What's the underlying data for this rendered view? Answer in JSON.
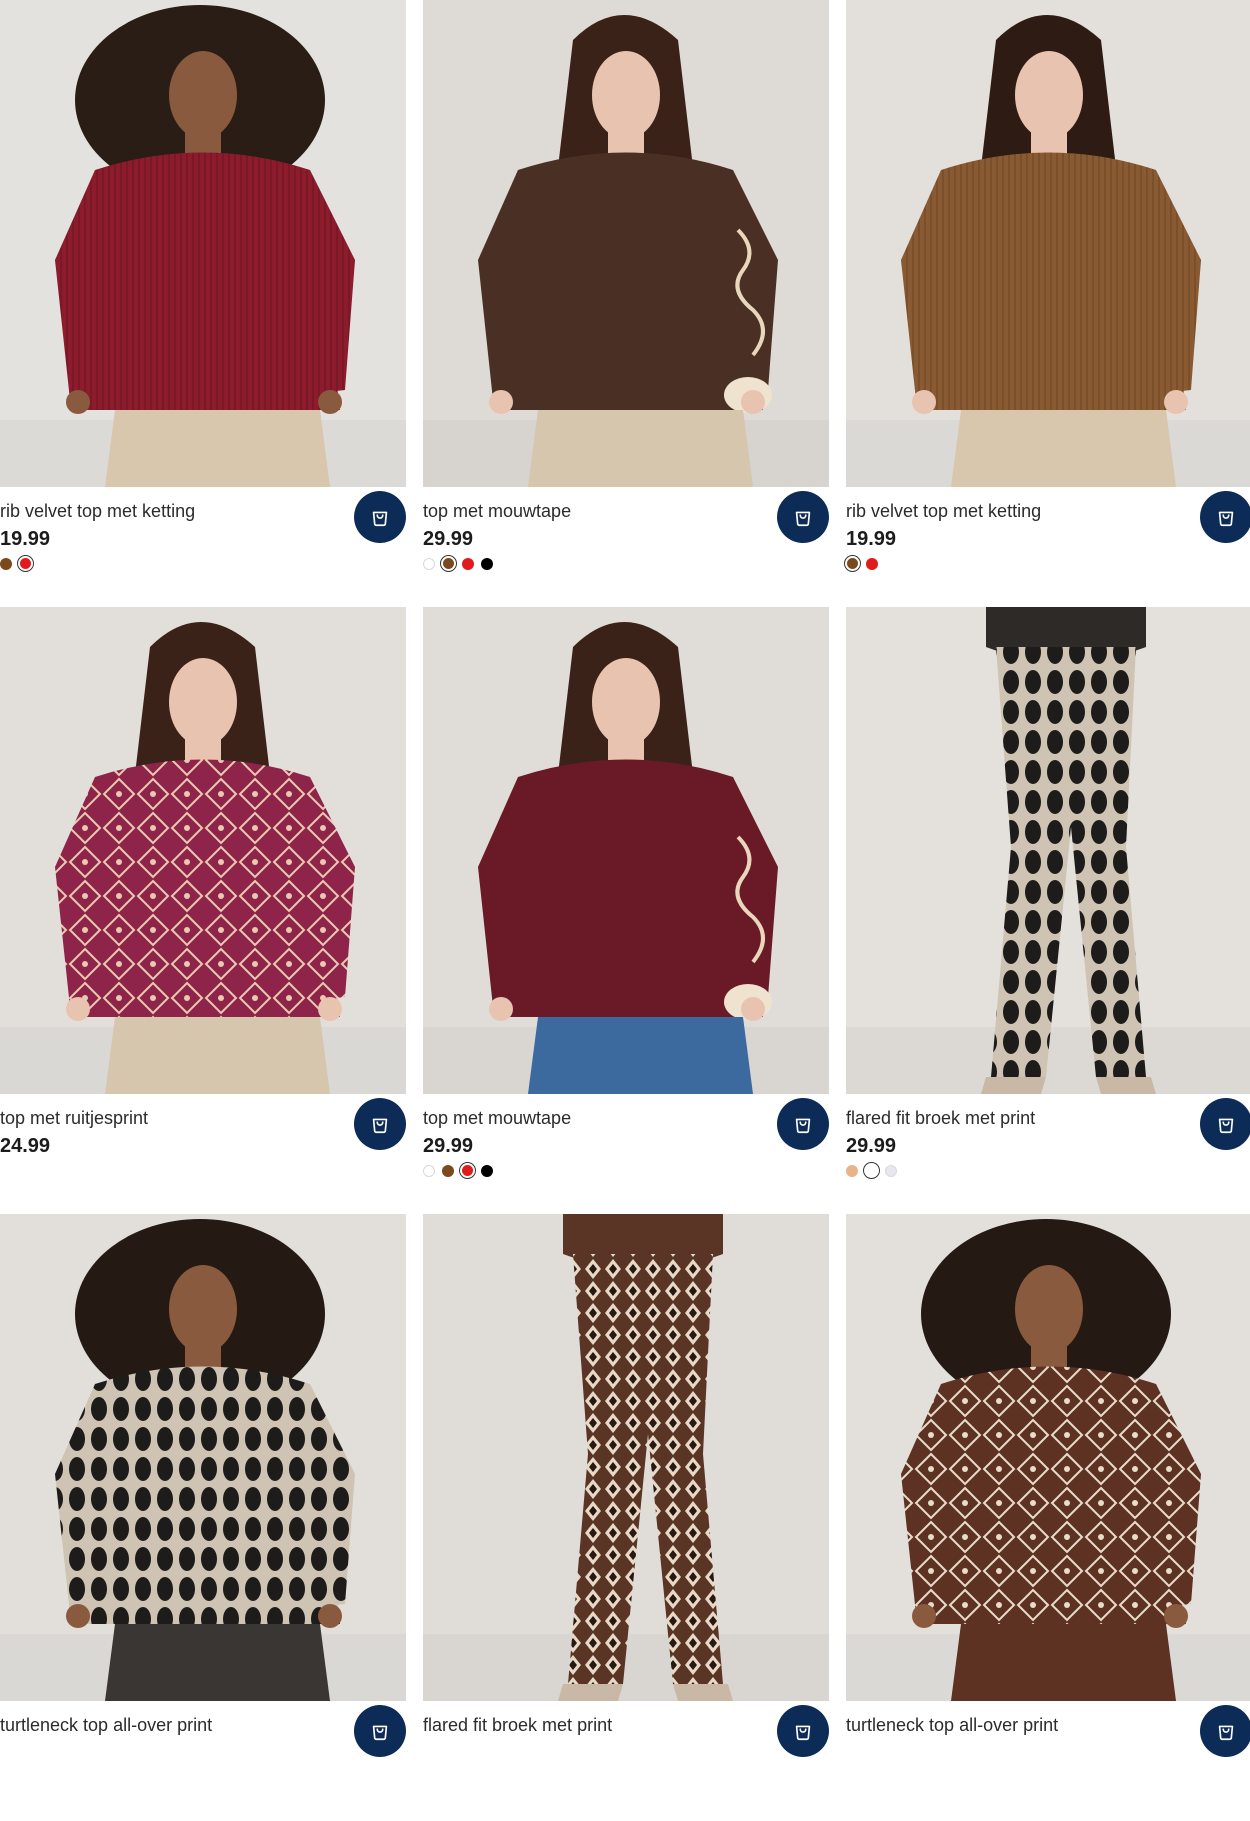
{
  "products": [
    {
      "title": "rib velvet top met ketting",
      "price": "19.99",
      "bg": "#e4e2de",
      "top": "#8c1b2c",
      "bottom": "#d8c7ad",
      "hair": "#2a1d16",
      "skin": "#8a5a3f",
      "pattern": "rib",
      "swatches": [
        {
          "color": "#7a4a1e"
        },
        {
          "color": "#e01b1b",
          "selected": true
        }
      ]
    },
    {
      "title": "top met mouwtape",
      "price": "29.99",
      "bg": "#dedad5",
      "top": "#4a3024",
      "bottom": "#d6c6ad",
      "hair": "#3a2218",
      "skin": "#e8c4b0",
      "pattern": "tape",
      "swatches": [
        {
          "color": "#ffffff",
          "light": true
        },
        {
          "color": "#7a4a1e",
          "selected": true
        },
        {
          "color": "#e01b1b"
        },
        {
          "color": "#000000"
        }
      ]
    },
    {
      "title": "rib velvet top met ketting",
      "price": "19.99",
      "bg": "#e3e0dc",
      "top": "#8a5a32",
      "bottom": "#d8c7ad",
      "hair": "#2e1c14",
      "skin": "#e8c4b0",
      "pattern": "rib",
      "swatches": [
        {
          "color": "#7a4a1e",
          "selected": true
        },
        {
          "color": "#e01b1b"
        }
      ]
    },
    {
      "title": "top met ruitjesprint",
      "price": "24.99",
      "bg": "#e2dfdb",
      "top": "#8e2449",
      "bottom": "#d6c6ad",
      "hair": "#3a2218",
      "skin": "#e8c4b0",
      "pattern": "diamond",
      "swatches": []
    },
    {
      "title": "top met mouwtape",
      "price": "29.99",
      "bg": "#e0ddd8",
      "top": "#6a1a26",
      "bottom": "#3d6a9e",
      "hair": "#3a2218",
      "skin": "#e8c4b0",
      "pattern": "tape",
      "swatches": [
        {
          "color": "#ffffff",
          "light": true
        },
        {
          "color": "#7a4a1e"
        },
        {
          "color": "#e01b1b",
          "selected": true
        },
        {
          "color": "#000000"
        }
      ]
    },
    {
      "title": "flared fit broek met print",
      "price": "29.99",
      "bg": "#e4e1dc",
      "top": "#2d2a28",
      "bottom": "#3a3430",
      "hair": "#2e1c14",
      "skin": "#e8c4b0",
      "pattern": "pants-dark",
      "swatches": [
        {
          "color": "#e8b48a"
        },
        {
          "color": "#ffffff",
          "selected": true
        },
        {
          "color": "#e8e6f2",
          "light": true
        }
      ]
    },
    {
      "title": "turtleneck top all-over print",
      "price": "",
      "bg": "#e2dfdb",
      "top": "#3a3634",
      "bottom": "#3a3634",
      "hair": "#241913",
      "skin": "#8a5a3f",
      "pattern": "oval",
      "swatches": []
    },
    {
      "title": "flared fit broek met print",
      "price": "",
      "bg": "#e0ddd8",
      "top": "#5a3424",
      "bottom": "#6a3a26",
      "hair": "#2e1c14",
      "skin": "#e8c4b0",
      "pattern": "pants-brown",
      "swatches": []
    },
    {
      "title": "turtleneck top all-over print",
      "price": "",
      "bg": "#e3e0dc",
      "top": "#5e3222",
      "bottom": "#5e3222",
      "hair": "#241913",
      "skin": "#8a5a3f",
      "pattern": "diamond-brown",
      "swatches": []
    }
  ]
}
